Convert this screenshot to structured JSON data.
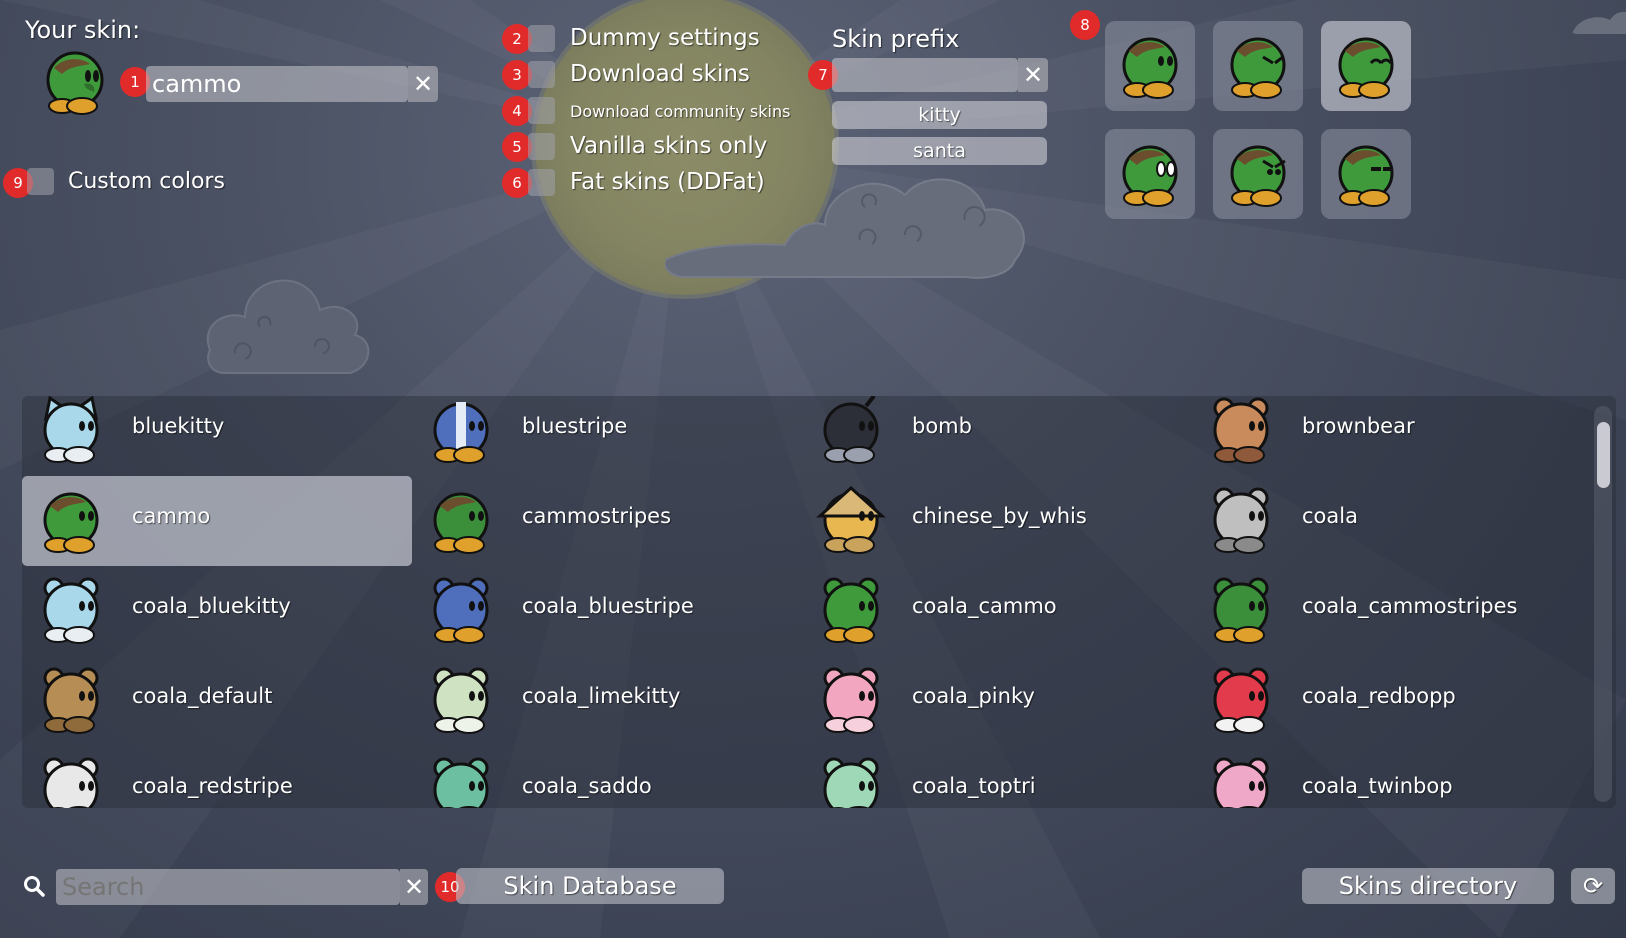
{
  "your_skin": {
    "label": "Your skin:",
    "name_value": "cammo",
    "clear_glyph": "✕"
  },
  "custom_colors": {
    "label": "Custom colors",
    "checked": false
  },
  "options": [
    {
      "label": "Dummy settings",
      "badge": "2"
    },
    {
      "label": "Download skins",
      "badge": "3"
    },
    {
      "label": "Download community skins",
      "badge": "4"
    },
    {
      "label": "Vanilla skins only",
      "badge": "5"
    },
    {
      "label": "Fat skins (DDFat)",
      "badge": "6"
    }
  ],
  "skin_prefix": {
    "label": "Skin prefix",
    "value": "",
    "clear_glyph": "✕",
    "presets": [
      "kitty",
      "santa"
    ]
  },
  "badges": {
    "name_field": "1",
    "prefix": "7",
    "eyes": "8",
    "custom_colors": "9",
    "skin_database": "10"
  },
  "eye_previews": [
    "normal",
    "pain",
    "happy",
    "surprise",
    "angry",
    "blink"
  ],
  "skins": [
    {
      "name": "bluekitty",
      "body": "#a9d8ea",
      "feet": "#e8eef2",
      "style": "kitty"
    },
    {
      "name": "bluestripe",
      "body": "#4f6fbd",
      "feet": "#e0a12c",
      "style": "stripe"
    },
    {
      "name": "bomb",
      "body": "#2d2f38",
      "feet": "#9aa0ad",
      "style": "bomb"
    },
    {
      "name": "brownbear",
      "body": "#c98a5c",
      "feet": "#8f5a3b",
      "style": "bear"
    },
    {
      "name": "cammo",
      "body": "#3f9a3c",
      "feet": "#e0a12c",
      "style": "cammo"
    },
    {
      "name": "cammostripes",
      "body": "#3b8f3a",
      "feet": "#e0a12c",
      "style": "cammo"
    },
    {
      "name": "chinese_by_whis",
      "body": "#e8b74f",
      "feet": "#c9a25c",
      "style": "hat"
    },
    {
      "name": "coala",
      "body": "#bfbfbf",
      "feet": "#8a8a8a",
      "style": "bear"
    },
    {
      "name": "coala_bluekitty",
      "body": "#a9d8ea",
      "feet": "#e8eef2",
      "style": "bear"
    },
    {
      "name": "coala_bluestripe",
      "body": "#4f6fbd",
      "feet": "#e0a12c",
      "style": "bear"
    },
    {
      "name": "coala_cammo",
      "body": "#3f9a3c",
      "feet": "#e0a12c",
      "style": "bear"
    },
    {
      "name": "coala_cammostripes",
      "body": "#3b8f3a",
      "feet": "#e0a12c",
      "style": "bear"
    },
    {
      "name": "coala_default",
      "body": "#b58d55",
      "feet": "#8f6a3b",
      "style": "bear"
    },
    {
      "name": "coala_limekitty",
      "body": "#cfe3c2",
      "feet": "#eef3ea",
      "style": "bear"
    },
    {
      "name": "coala_pinky",
      "body": "#f2a6c0",
      "feet": "#f7d0de",
      "style": "bear"
    },
    {
      "name": "coala_redbopp",
      "body": "#e23b4c",
      "feet": "#f2f2f2",
      "style": "bear"
    },
    {
      "name": "coala_redstripe",
      "body": "#e8e8e8",
      "feet": "#d83040",
      "style": "bear"
    },
    {
      "name": "coala_saddo",
      "body": "#6cbfa0",
      "feet": "#4f9b80",
      "style": "bear"
    },
    {
      "name": "coala_toptri",
      "body": "#9fd8b6",
      "feet": "#e8f2ec",
      "style": "bear"
    },
    {
      "name": "coala_twinbop",
      "body": "#f0a8c8",
      "feet": "#f7d6e4",
      "style": "bear"
    }
  ],
  "selected_skin": "cammo",
  "search": {
    "placeholder": "Search",
    "value": "",
    "clear_glyph": "✕"
  },
  "buttons": {
    "skin_database": "Skin Database",
    "skins_directory": "Skins directory",
    "refresh_glyph": "⟳"
  },
  "colors": {
    "accent_badge": "#e12b2b",
    "selection": "#c3c6d0"
  }
}
